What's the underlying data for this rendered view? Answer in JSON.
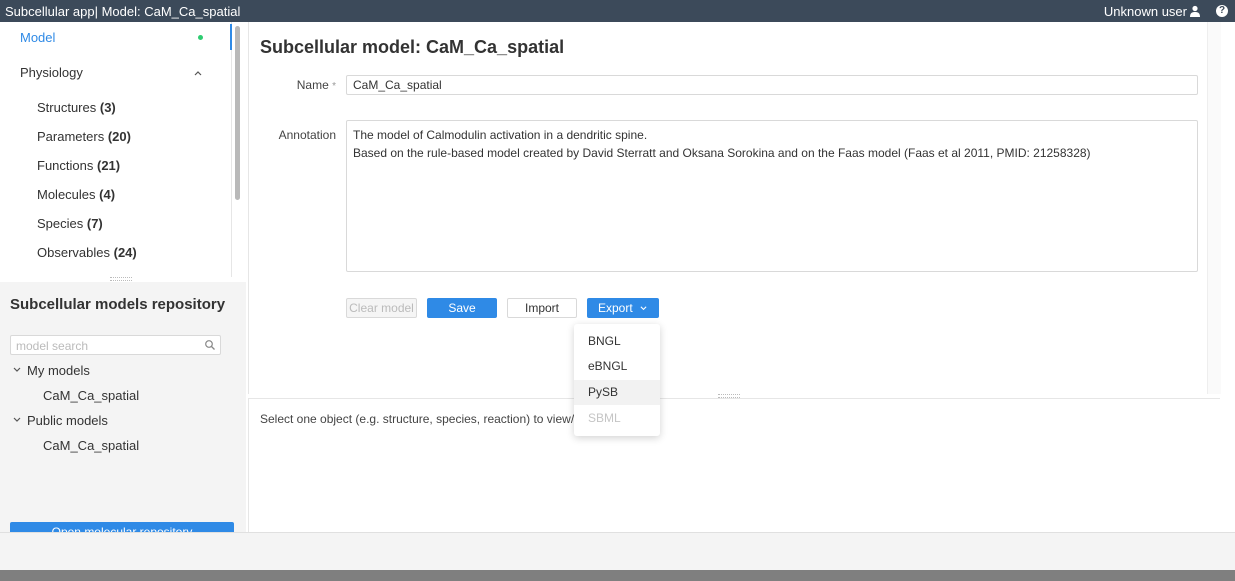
{
  "titlebar": {
    "title": "Subcellular app| Model: CaM_Ca_spatial",
    "user": "Unknown user",
    "user_icon": "user-icon",
    "help_icon": "question-icon",
    "help_glyph": "?"
  },
  "nav": {
    "model_label": "Model",
    "physiology_label": "Physiology",
    "items": [
      {
        "label": "Structures",
        "count": "(3)"
      },
      {
        "label": "Parameters",
        "count": "(20)"
      },
      {
        "label": "Functions",
        "count": "(21)"
      },
      {
        "label": "Molecules",
        "count": "(4)"
      },
      {
        "label": "Species",
        "count": "(7)"
      },
      {
        "label": "Observables",
        "count": "(24)"
      }
    ]
  },
  "repo": {
    "title": "Subcellular models repository",
    "search_placeholder": "model search",
    "my_models_label": "My models",
    "my_models": [
      "CaM_Ca_spatial"
    ],
    "public_models_label": "Public models",
    "public_models": [
      "CaM_Ca_spatial"
    ],
    "open_button": "Open molecular repository"
  },
  "main": {
    "title": "Subcellular model: CaM_Ca_spatial",
    "name_label": "Name",
    "required_mark": "*",
    "name_value": "CaM_Ca_spatial",
    "annotation_label": "Annotation",
    "annotation_lines": [
      "The model of Calmodulin activation in a dendritic spine.",
      "Based on the rule-based model created by David Sterratt and Oksana Sorokina and on the Faas model (Faas et al 2011, PMID: 21258328)"
    ],
    "buttons": {
      "clear": "Clear model",
      "save": "Save",
      "import": "Import",
      "export": "Export"
    }
  },
  "export_menu": {
    "items": [
      {
        "label": "BNGL",
        "state": "normal"
      },
      {
        "label": "eBNGL",
        "state": "normal"
      },
      {
        "label": "PySB",
        "state": "hover"
      },
      {
        "label": "SBML",
        "state": "disabled"
      }
    ]
  },
  "detail": {
    "hint": "Select one object (e.g. structure, species, reaction) to view/edit"
  },
  "colors": {
    "accent": "#2f8ae6",
    "titlebar": "#3c4a5a",
    "status_dot": "#2ecc71"
  }
}
